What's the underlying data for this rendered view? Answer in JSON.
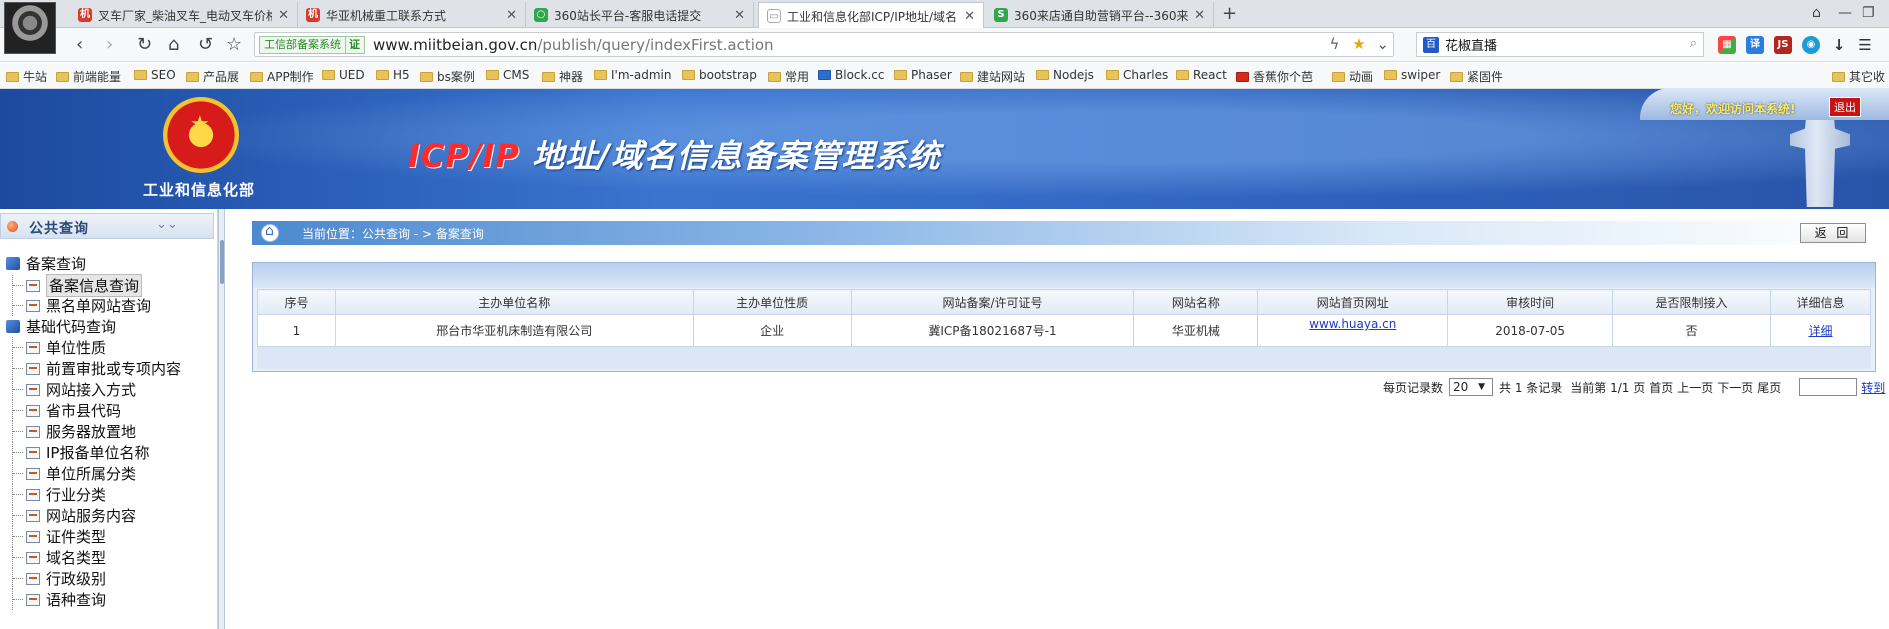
{
  "browser": {
    "tabs": [
      {
        "icon": "机",
        "color": "#d83a2c",
        "title": "叉车厂家_柴油叉车_电动叉车价格"
      },
      {
        "icon": "机",
        "color": "#d83a2c",
        "title": "华亚机械重工联系方式"
      },
      {
        "icon": "○",
        "color": "#2ea84a",
        "title": "360站长平台-客服电话提交"
      },
      {
        "icon": "▭",
        "color": "#8a8a8a",
        "title": "工业和信息化部ICP/IP地址/域名"
      },
      {
        "icon": "S",
        "color": "#2ea84a",
        "title": "360来店通自助营销平台--360来"
      }
    ],
    "cert_label": "工信部备案系统",
    "cert_mark": "证",
    "url_host": "www.miitbeian.gov.cn",
    "url_path": "/publish/query/indexFirst.action",
    "search_query": "花椒直播",
    "bookmarks": [
      "牛站",
      "前端能量",
      "SEO",
      "产品展",
      "APP制作",
      "UED",
      "H5",
      "bs案例",
      "CMS",
      "神器",
      "I'm-admin",
      "bootstrap",
      "常用",
      "Block.cc",
      "Phaser",
      "建站网站",
      "Nodejs",
      "Charles",
      "React",
      "香蕉你个芭",
      "动画",
      "swiper",
      "紧固件",
      "其它收"
    ]
  },
  "header": {
    "ministry": "工业和信息化部",
    "system_name_prefix": "ICP/IP",
    "system_name_rest": " 地址/域名信息备案管理系统",
    "welcome": "您好，欢迎访问本系统!",
    "logout": "退出"
  },
  "sidebar": {
    "title": "公共查询",
    "groups": [
      {
        "label": "备案查询",
        "items": [
          "备案信息查询",
          "黑名单网站查询"
        ]
      },
      {
        "label": "基础代码查询",
        "items": [
          "单位性质",
          "前置审批或专项内容",
          "网站接入方式",
          "省市县代码",
          "服务器放置地",
          "IP报备单位名称",
          "单位所属分类",
          "行业分类",
          "网站服务内容",
          "证件类型",
          "域名类型",
          "行政级别",
          "语种查询"
        ]
      }
    ]
  },
  "content": {
    "breadcrumb": "当前位置：公共查询  - >  备案查询",
    "back_button": "返 回",
    "columns": [
      "序号",
      "主办单位名称",
      "主办单位性质",
      "网站备案/许可证号",
      "网站名称",
      "网站首页网址",
      "审核时间",
      "是否限制接入",
      "详细信息"
    ],
    "rows": [
      [
        "1",
        "邢台市华亚机床制造有限公司",
        "企业",
        "冀ICP备18021687号-1",
        "华亚机械",
        "www.huaya.cn",
        "2018-07-05",
        "否",
        "详细"
      ]
    ],
    "pager": {
      "per_page_label": "每页记录数",
      "per_page_value": "20",
      "total": "共 1 条记录",
      "page_info": "当前第 1/1 页",
      "first": "首页",
      "prev": "上一页",
      "next": "下一页",
      "last": "尾页",
      "jump": "转到"
    }
  }
}
